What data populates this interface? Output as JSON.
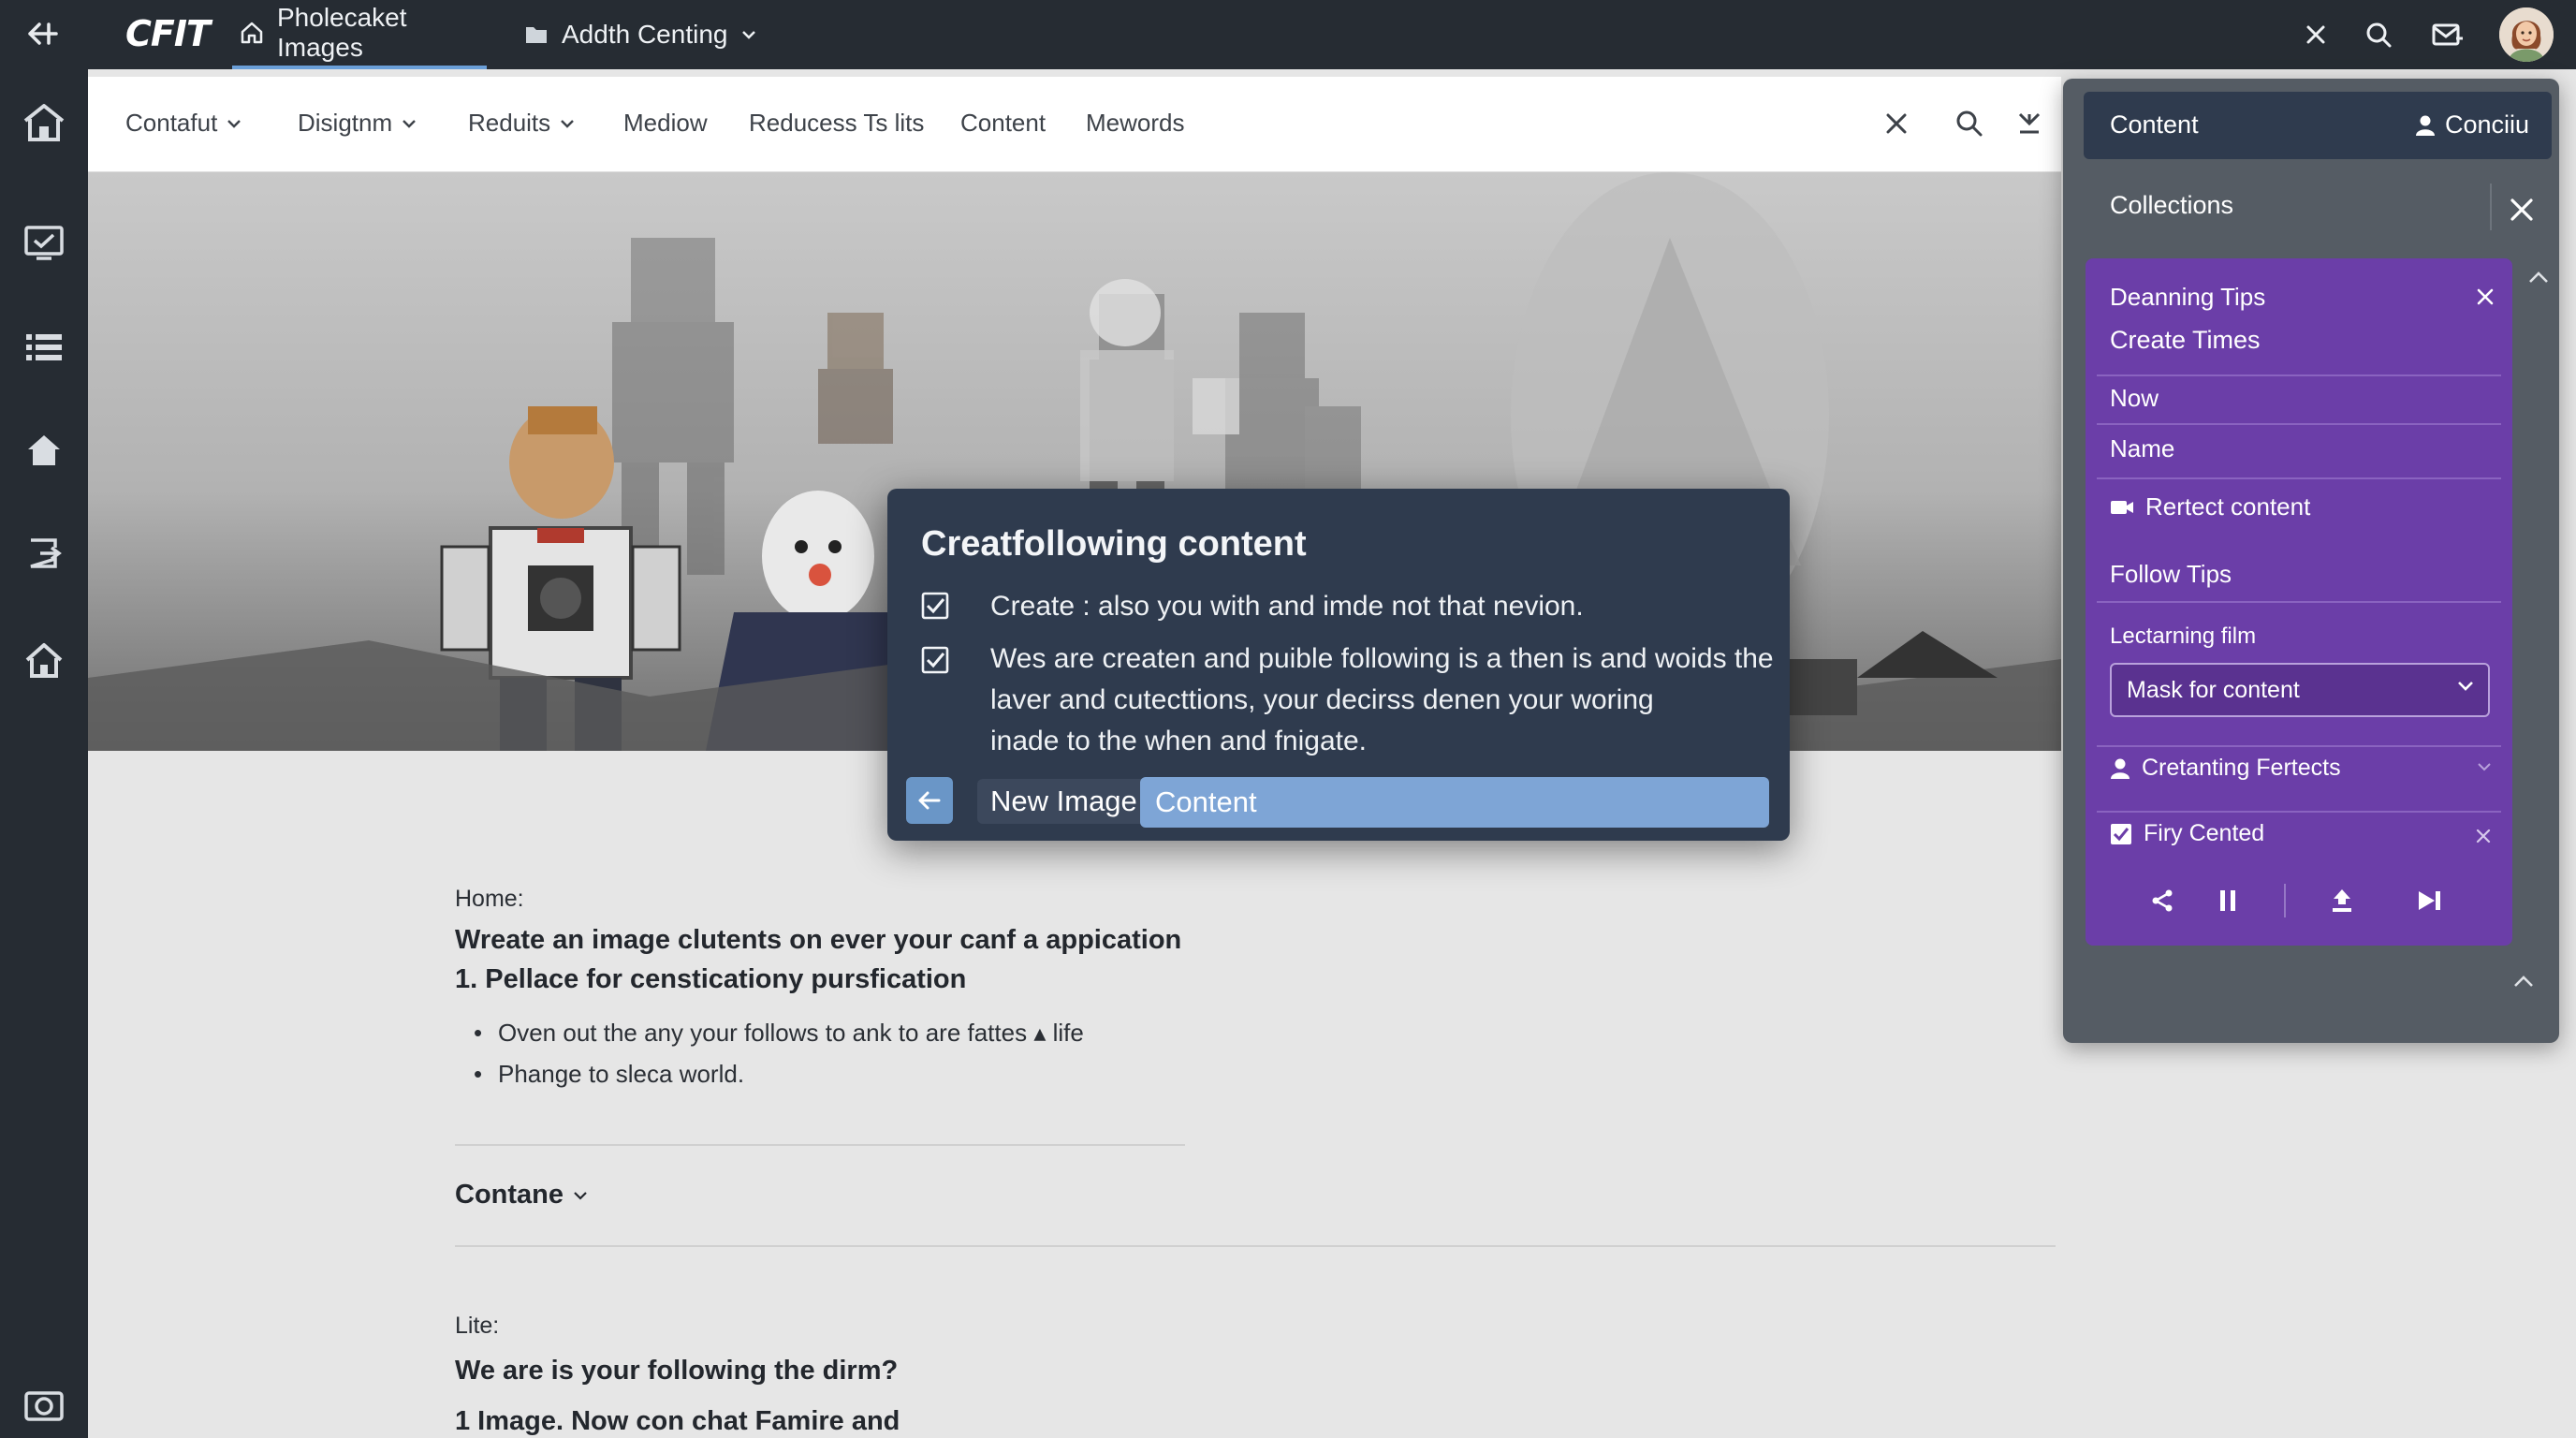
{
  "app": {
    "logo": "CFIT"
  },
  "titlebar": {
    "tabs": [
      {
        "label": "Pholecaket Images",
        "icon": "home-icon",
        "active": true
      },
      {
        "label": "Addth Centing",
        "icon": "folder-icon",
        "active": false
      }
    ]
  },
  "nav": {
    "items": [
      {
        "label": "Contafut",
        "dropdown": true
      },
      {
        "label": "Disigtnm",
        "dropdown": true
      },
      {
        "label": "Reduits",
        "dropdown": true
      },
      {
        "label": "Mediow",
        "dropdown": false
      },
      {
        "label": "Reducess Ts lits",
        "dropdown": false
      },
      {
        "label": "Content",
        "dropdown": false
      },
      {
        "label": "Mewords",
        "dropdown": false
      }
    ]
  },
  "modal": {
    "title": "Creatfollowing content",
    "checks": [
      {
        "lines": [
          "Create : also you with and imde not that nevion."
        ]
      },
      {
        "lines": [
          "Wes are createn and puible following is a then is and woids the",
          "laver and cutecttions, your decirss denen your woring",
          "inade to the when and fnigate."
        ]
      }
    ],
    "new_label": "New Image",
    "input_value": "Content"
  },
  "content": {
    "home_label": "Home:",
    "heading1": "Wreate an image clutents on ever your canf a appication",
    "heading2": "1. Pellace for censticationy pursfication",
    "bullets": [
      "Oven out the any your follows to ank to are fattes ▴ life",
      "Phange to sleca world."
    ],
    "section_label": "Contane",
    "lite_label": "Lite:",
    "question": "We are is your following the dirm?",
    "item": "1 Image. Now con chat Famire and"
  },
  "rpanel": {
    "header_label": "Content",
    "header_user": "Conciiu",
    "collections_label": "Collections",
    "rows": {
      "r1": "Deanning Tips",
      "r2": "Create Times",
      "r3": "Now",
      "r4": "Name",
      "r5": "Rertect content",
      "r6": "Follow Tips",
      "r7": "Lectarning film"
    },
    "select_value": "Mask for content",
    "row_person": "Cretanting Fertects",
    "row_check": "Firy Cented"
  },
  "colors": {
    "titlebar": "#262c33",
    "accent": "#6a9fd8",
    "modal": "#2f3b4e",
    "purple": "#6b3ea8",
    "input": "#7ea5d6"
  }
}
